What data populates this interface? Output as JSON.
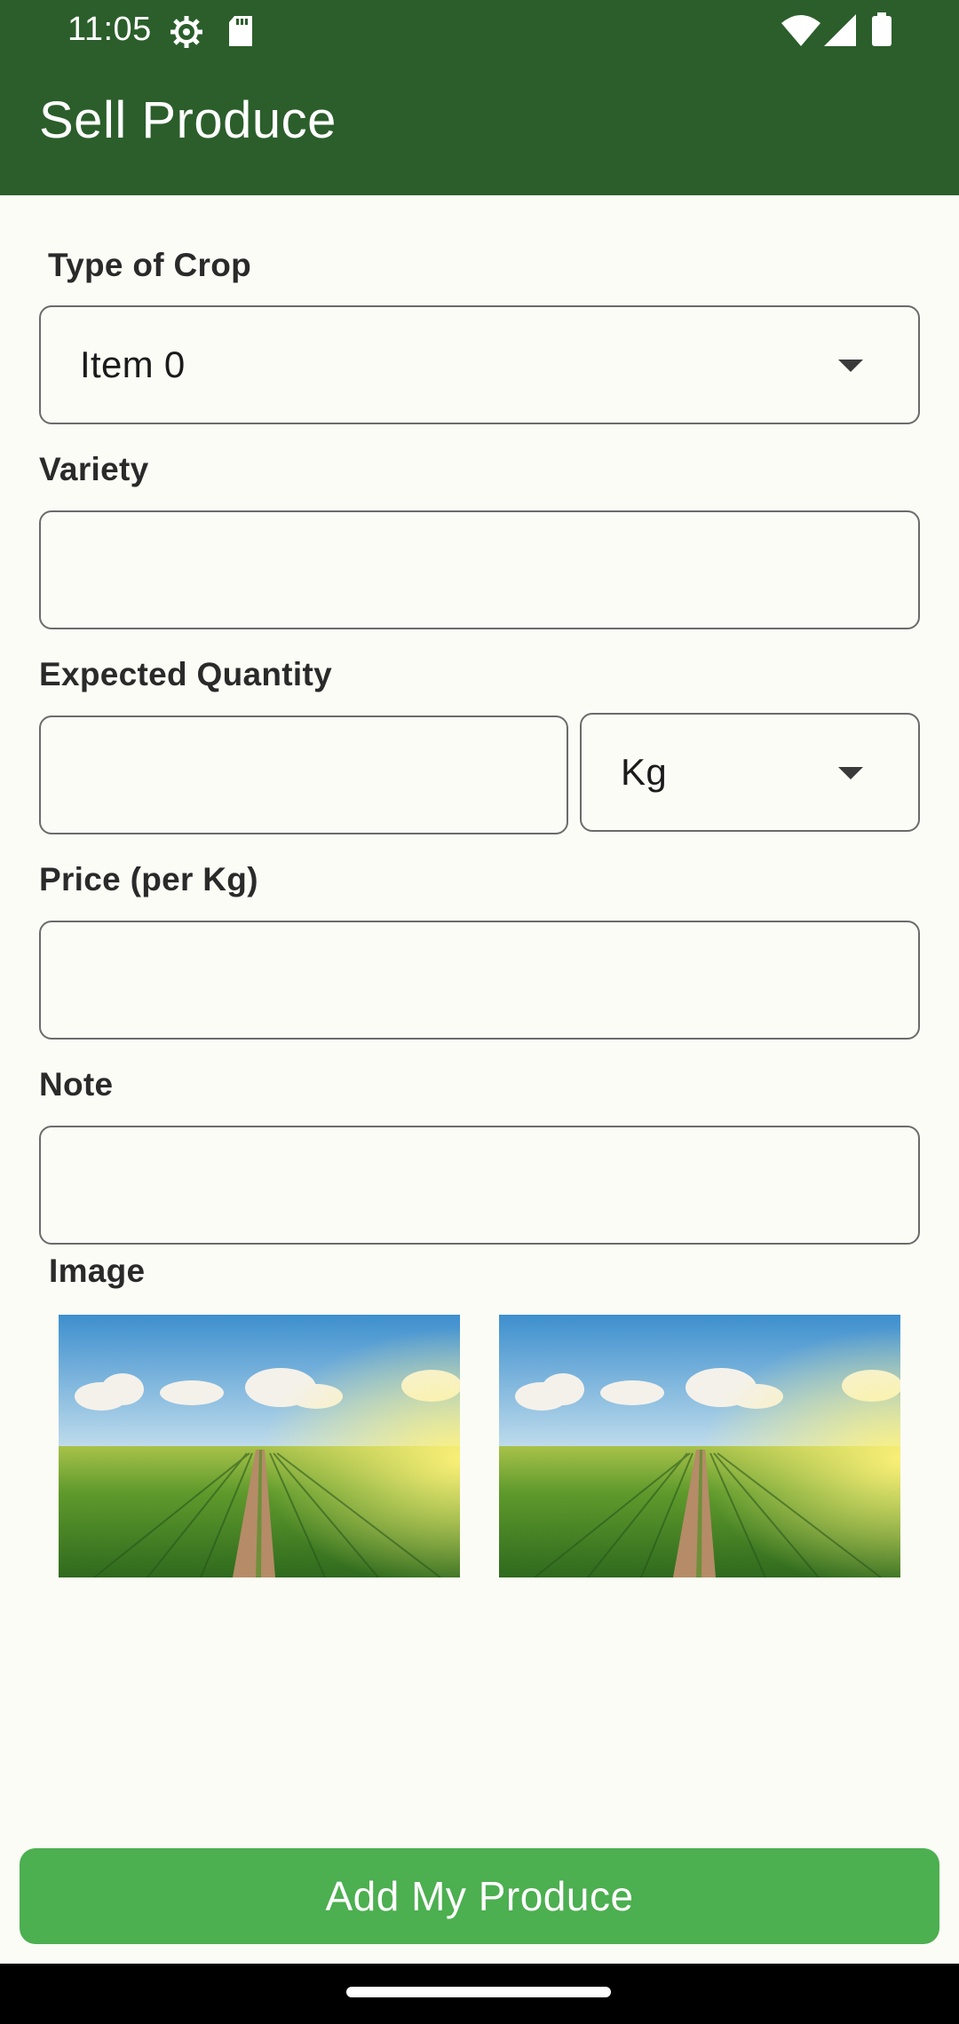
{
  "status_bar": {
    "time": "11:05"
  },
  "app_bar": {
    "title": "Sell Produce"
  },
  "form": {
    "crop_type": {
      "label": "Type of Crop",
      "selected": "Item 0"
    },
    "variety": {
      "label": "Variety",
      "value": ""
    },
    "expected_quantity": {
      "label": "Expected Quantity",
      "value": "",
      "unit_selected": "Kg"
    },
    "price": {
      "label": "Price (per Kg)",
      "value": ""
    },
    "note": {
      "label": "Note",
      "value": ""
    },
    "image": {
      "label": "Image"
    }
  },
  "submit": {
    "label": "Add My Produce"
  },
  "colors": {
    "app_bar": "#2b5e2b",
    "submit_button": "#4caf50",
    "background": "#fbfcf6"
  },
  "icons": [
    "settings-icon",
    "sd-card-icon",
    "wifi-icon",
    "signal-icon",
    "battery-icon",
    "dropdown-arrow-icon"
  ]
}
